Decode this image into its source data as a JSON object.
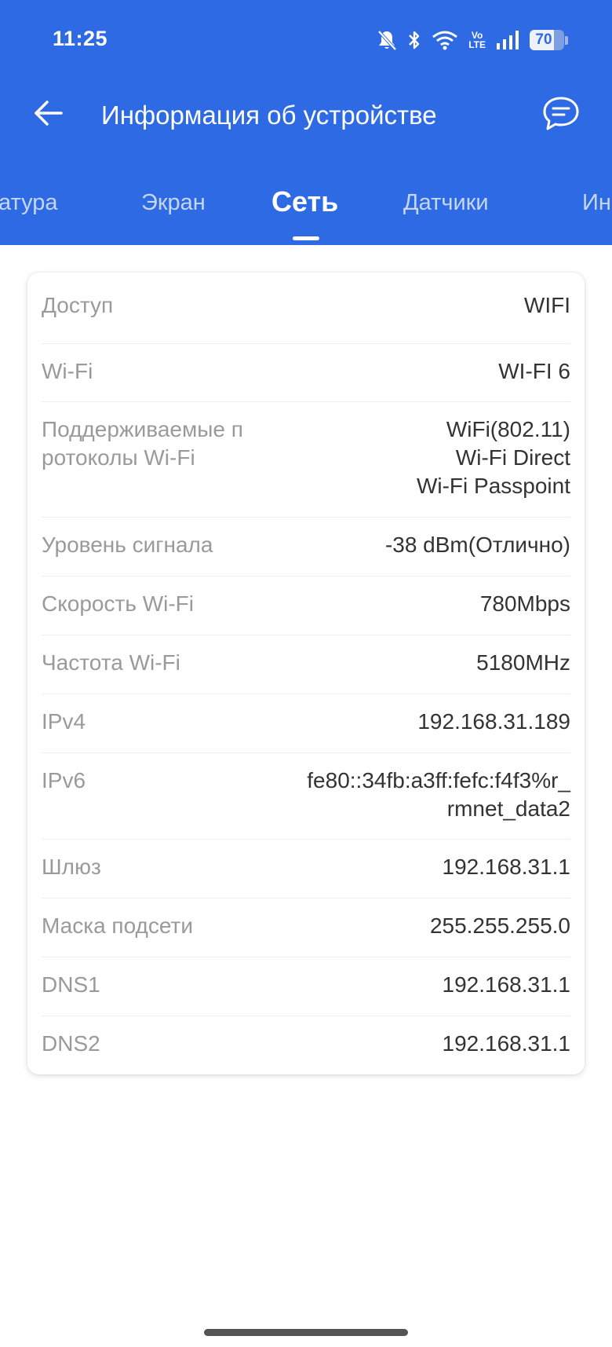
{
  "status_bar": {
    "time": "11:25",
    "volte_top": "Vo",
    "volte_bottom": "LTE",
    "battery_level": "70",
    "battery_fraction": 0.7,
    "icons": [
      "bell-off-icon",
      "bluetooth-icon",
      "wifi-icon",
      "volte-icon",
      "cell-signal-icon",
      "battery-icon"
    ]
  },
  "header": {
    "title": "Информация об устройстве",
    "back_icon": "arrow-left-icon",
    "feedback_icon": "chat-bubble-icon",
    "background_color": "#2d6ae3"
  },
  "tabs": [
    {
      "label": "атура",
      "active": false
    },
    {
      "label": "Экран",
      "active": false
    },
    {
      "label": "Сеть",
      "active": true
    },
    {
      "label": "Датчики",
      "active": false
    },
    {
      "label": "Ин",
      "active": false
    }
  ],
  "network_info": [
    {
      "label": "Доступ",
      "value": [
        "WIFI"
      ]
    },
    {
      "label": "Wi-Fi",
      "value": [
        "WI-FI 6"
      ]
    },
    {
      "label": "Поддерживаемые протоколы Wi-Fi",
      "value": [
        "WiFi(802.11)",
        "Wi-Fi Direct",
        "Wi-Fi Passpoint"
      ]
    },
    {
      "label": "Уровень сигнала",
      "value": [
        "-38 dBm(Отлично)"
      ]
    },
    {
      "label": "Скорость Wi-Fi",
      "value": [
        "780Mbps"
      ]
    },
    {
      "label": "Частота Wi-Fi",
      "value": [
        "5180MHz"
      ]
    },
    {
      "label": "IPv4",
      "value": [
        "192.168.31.189"
      ]
    },
    {
      "label": "IPv6",
      "value": [
        "fe80::34fb:a3ff:fefc:f4f3%r_",
        "rmnet_data2"
      ]
    },
    {
      "label": "Шлюз",
      "value": [
        "192.168.31.1"
      ]
    },
    {
      "label": "Маска подсети",
      "value": [
        "255.255.255.0"
      ]
    },
    {
      "label": "DNS1",
      "value": [
        "192.168.31.1"
      ]
    },
    {
      "label": "DNS2",
      "value": [
        "192.168.31.1"
      ]
    }
  ]
}
